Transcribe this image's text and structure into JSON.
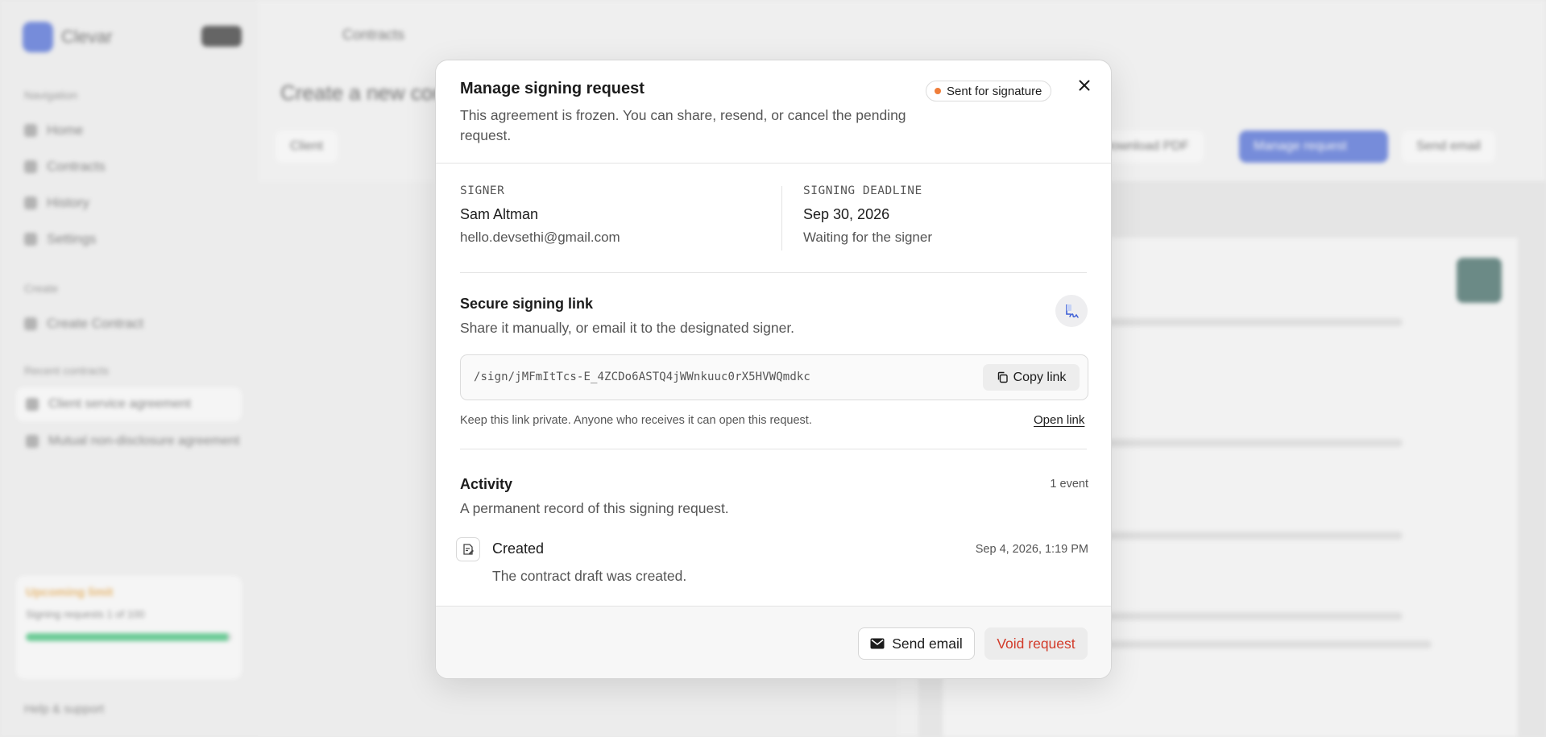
{
  "background": {
    "brand": "Clevar",
    "breadcrumb": "Contracts",
    "nav": [
      "Home",
      "Contracts",
      "History",
      "Settings"
    ],
    "create_item": "Create Contract",
    "recent": [
      "Client service agreement",
      "Mutual non-disclosure agreement"
    ],
    "accent": "#3d5fd6"
  },
  "modal": {
    "title": "Manage signing request",
    "subtitle": "This agreement is frozen. You can share, resend, or cancel the pending request.",
    "status": "Sent for signature",
    "status_color": "#ef7d3a",
    "signer": {
      "label": "SIGNER",
      "name": "Sam Altman",
      "email": "hello.devsethi@gmail.com"
    },
    "deadline": {
      "label": "SIGNING DEADLINE",
      "date": "Sep 30, 2026",
      "status": "Waiting for the signer"
    },
    "link": {
      "title": "Secure signing link",
      "subtitle": "Share it manually, or email it to the designated signer.",
      "url": "/sign/jMFmItTcs-E_4ZCDo6ASTQ4jWWnkuuc0rX5HVWQmdkc",
      "copy_label": "Copy link",
      "note": "Keep this link private. Anyone who receives it can open this request.",
      "open_label": "Open link"
    },
    "activity": {
      "title": "Activity",
      "subtitle": "A permanent record of this signing request.",
      "count": "1 event",
      "events": [
        {
          "title": "Created",
          "time": "Sep 4, 2026, 1:19 PM",
          "description": "The contract draft was created."
        }
      ]
    },
    "footer": {
      "send_label": "Send email",
      "void_label": "Void request",
      "void_color": "#d23b2a"
    }
  }
}
